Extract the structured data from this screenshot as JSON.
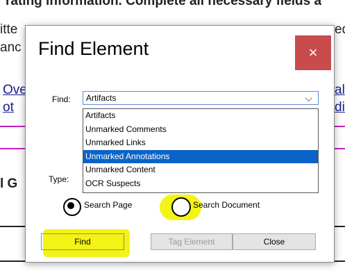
{
  "background": {
    "line1": "rating information. Complete all necessary fields a",
    "line2a": "itte",
    "line2b": "eq",
    "line3a": "anc",
    "line4a": "Ove",
    "line4b": "al",
    "line5a": "ot",
    "line5b": "dit",
    "line6a": "l G",
    "accent_color": "#c020c0"
  },
  "dialog": {
    "title": "Find Element",
    "close_glyph": "×",
    "find_label": "Find:",
    "type_label": "Type:",
    "find_value": "Artifacts",
    "caret": "⌵",
    "options": [
      "Artifacts",
      "Unmarked Comments",
      "Unmarked Links",
      "Unmarked Annotations",
      "Unmarked Content",
      "OCR Suspects"
    ],
    "selected_option": "Unmarked Annotations",
    "search_page_label": "Search Page",
    "search_document_label": "Search Document",
    "find_button": "Find",
    "tag_element_button": "Tag Element",
    "close_button": "Close",
    "highlight_color": "#f2f20a",
    "close_bg_color": "#c94c4c",
    "selection_color": "#0a64c8"
  }
}
